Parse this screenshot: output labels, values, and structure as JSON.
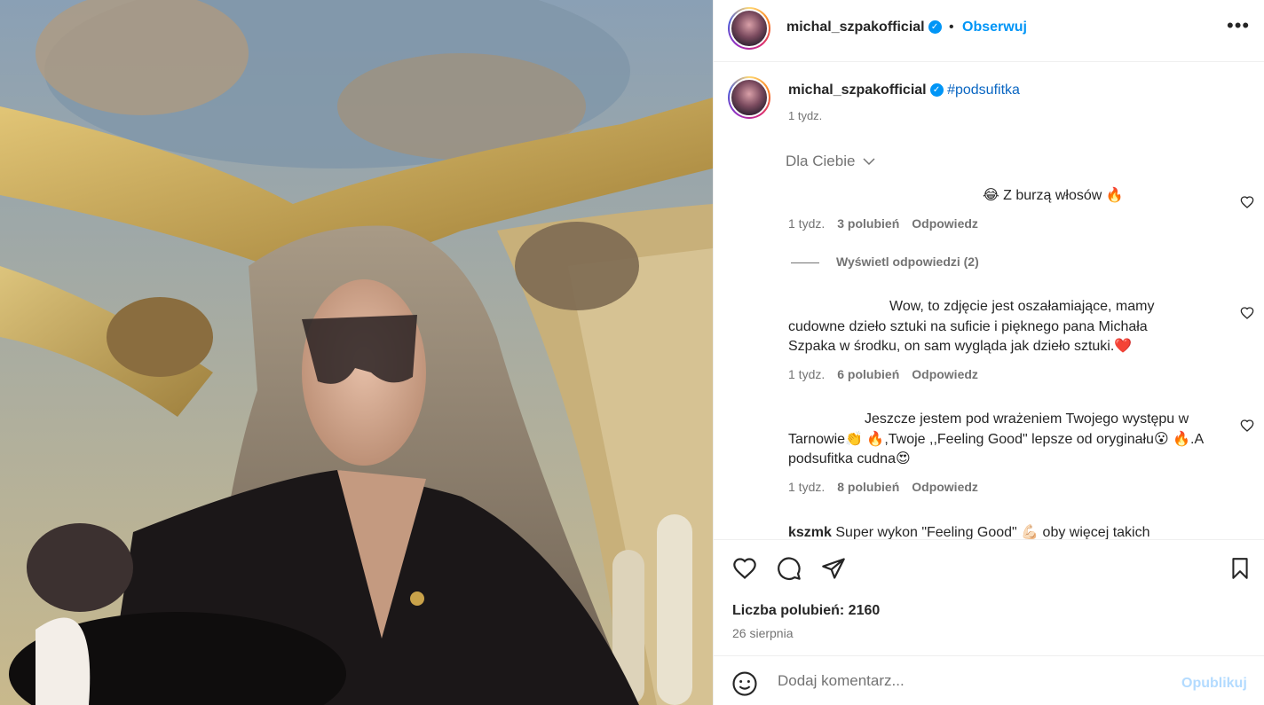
{
  "post": {
    "username": "michal_szpakofficial",
    "verified_icon": "verified-badge-icon",
    "follow_label": "Obserwuj",
    "separator": "•",
    "caption_hashtag": "#podsufitka",
    "caption_time": "1 tydz.",
    "sort_label": "Dla Ciebie"
  },
  "comments": [
    {
      "author": "",
      "text": "😂 Z burzą włosów 🔥",
      "time": "1 tydz.",
      "likes": "3 polubień",
      "reply": "Odpowiedz",
      "view_replies": "Wyświetl odpowiedzi (2)"
    },
    {
      "author": "",
      "text": "Wow, to zdjęcie jest oszałamiające, mamy cudowne dzieło sztuki na suficie i pięknego pana Michała Szpaka w środku, on sam wygląda jak dzieło sztuki.❤️",
      "time": "1 tydz.",
      "likes": "6 polubień",
      "reply": "Odpowiedz"
    },
    {
      "author": "",
      "text": "Jeszcze jestem pod wrażeniem Twojego występu w Tarnowie👏 🔥,Twoje ,,Feeling Good\" lepsze od oryginału😮 🔥.A podsufitka cudna😍",
      "time": "1 tydz.",
      "likes": "8 polubień",
      "reply": "Odpowiedz"
    },
    {
      "author": "kszmk",
      "text": "Super wykon \"Feeling Good\" 💪🏻 oby więcej takich",
      "time": "",
      "likes": "",
      "reply": ""
    }
  ],
  "footer": {
    "likes_label": "Liczba polubień: 2160",
    "date": "26 sierpnia",
    "comment_placeholder": "Dodaj komentarz...",
    "publish_label": "Opublikuj"
  },
  "colors": {
    "link_blue": "#0095f6",
    "hashtag_blue": "#0a66c2",
    "muted": "#737373",
    "publish_disabled": "#b3dbff"
  }
}
